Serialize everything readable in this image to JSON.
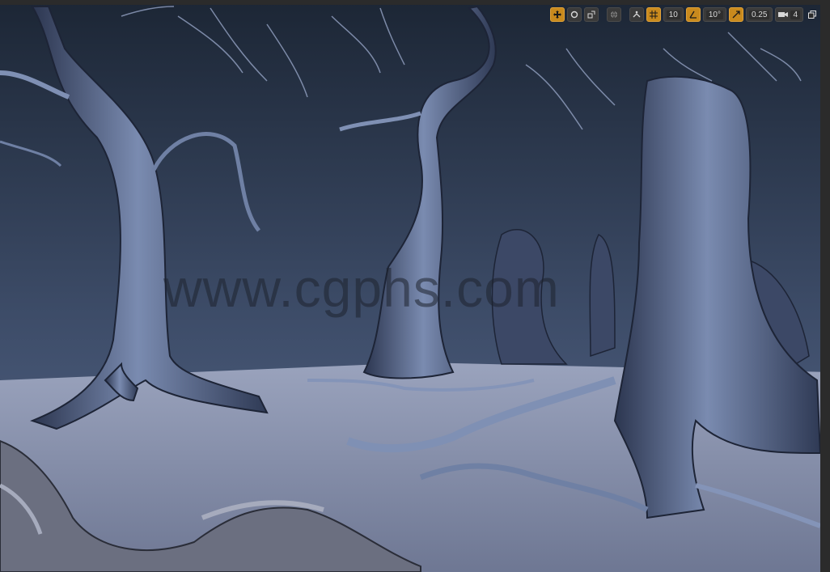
{
  "viewport": {
    "watermark_text": "www.cgphs.com",
    "colors": {
      "sky_top": "#1f2a3a",
      "sky_bottom": "#4d5e7c",
      "ground": "#8f99b3",
      "bark": "#4a5a7a"
    }
  },
  "toolbar": {
    "grid_snap_value": "10",
    "rotation_snap_value": "10°",
    "scale_snap_value": "0.25",
    "camera_speed_value": "4",
    "icons": [
      "translate-icon",
      "rotate-icon",
      "scale-icon",
      "world-space-icon",
      "surface-snap-icon",
      "grid-icon",
      "angle-icon",
      "scale-snap-icon",
      "camera-speed-icon",
      "maximize-icon"
    ]
  }
}
